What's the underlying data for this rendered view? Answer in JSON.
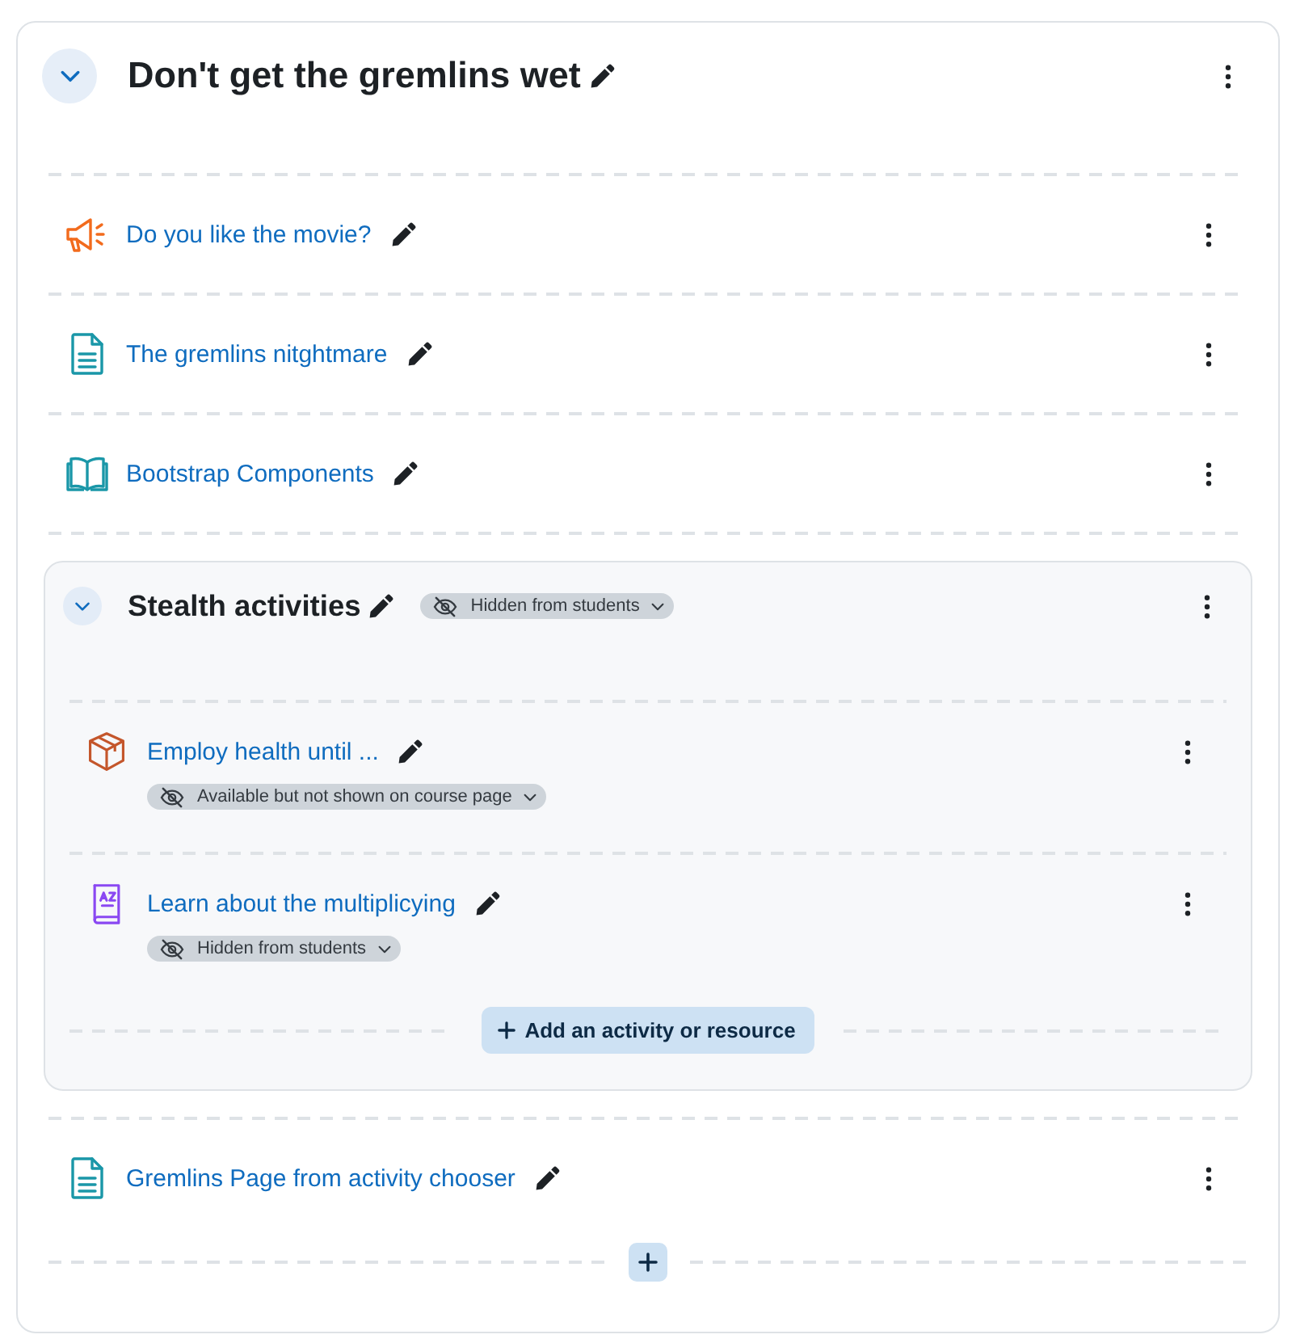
{
  "section": {
    "title": "Don't get the gremlins wet",
    "expanded": true,
    "items": [
      {
        "kind": "forum",
        "name": "Do you like the movie?"
      },
      {
        "kind": "page",
        "name": "The gremlins nitghtmare"
      },
      {
        "kind": "book",
        "name": "Bootstrap Components"
      },
      {
        "kind": "subsection",
        "title": "Stealth activities",
        "expanded": true,
        "badge": "Hidden from students",
        "items": [
          {
            "kind": "scorm",
            "name": "Employ health until ...",
            "badge": "Available but not shown on course page"
          },
          {
            "kind": "glossary",
            "name": "Learn about the multiplicying",
            "badge": "Hidden from students"
          }
        ],
        "add_button": "Add an activity or resource"
      },
      {
        "kind": "page",
        "name": "Gremlins Page from activity chooser"
      }
    ]
  }
}
